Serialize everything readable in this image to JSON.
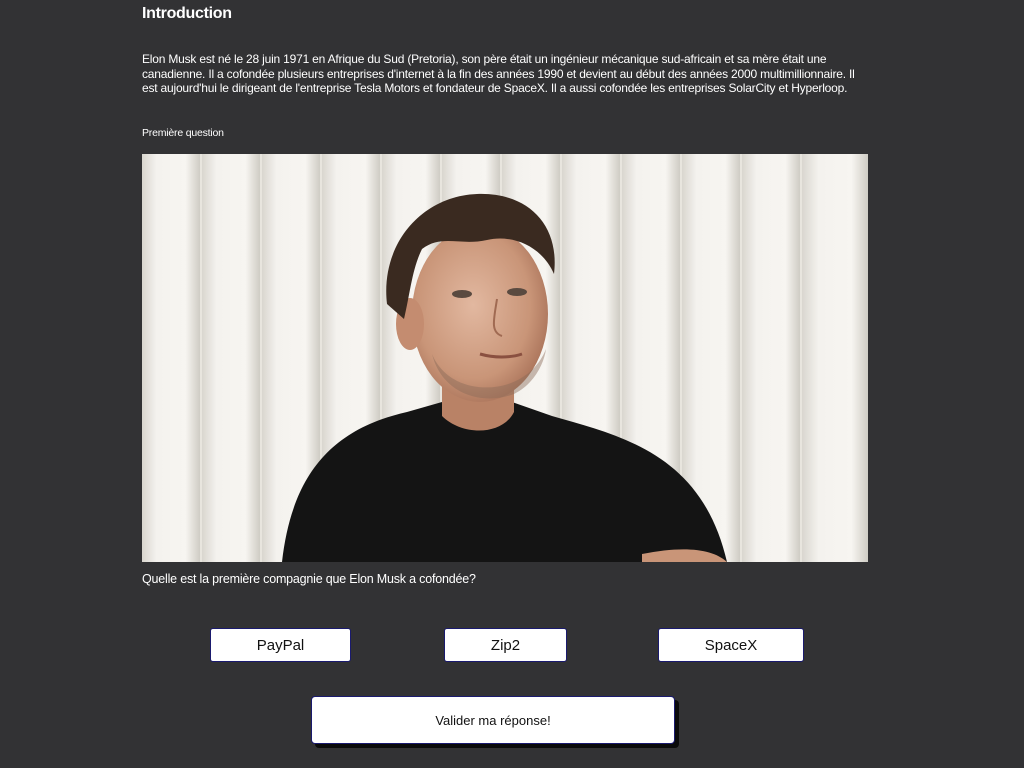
{
  "header": {
    "title": "Introduction"
  },
  "intro": {
    "text": "Elon Musk est né le 28 juin 1971 en Afrique du Sud (Pretoria), son père était un ingénieur mécanique sud-africain et sa mère était une canadienne. Il a cofondée plusieurs entreprises d'internet à la fin des années 1990 et devient au début des années 2000 multimillionnaire. Il est aujourd'hui le dirigeant de l'entreprise Tesla Motors et fondateur de SpaceX. Il a aussi cofondée les entreprises SolarCity et Hyperloop."
  },
  "quiz": {
    "section_label": "Première question",
    "question": "Quelle est la première compagnie que Elon Musk a cofondée?",
    "answers": [
      {
        "label": "PayPal"
      },
      {
        "label": "Zip2"
      },
      {
        "label": "SpaceX"
      }
    ],
    "submit_label": "Valider ma réponse!"
  },
  "colors": {
    "background": "#323234",
    "text": "#ffffff",
    "button_border": "#1a1a6e"
  }
}
